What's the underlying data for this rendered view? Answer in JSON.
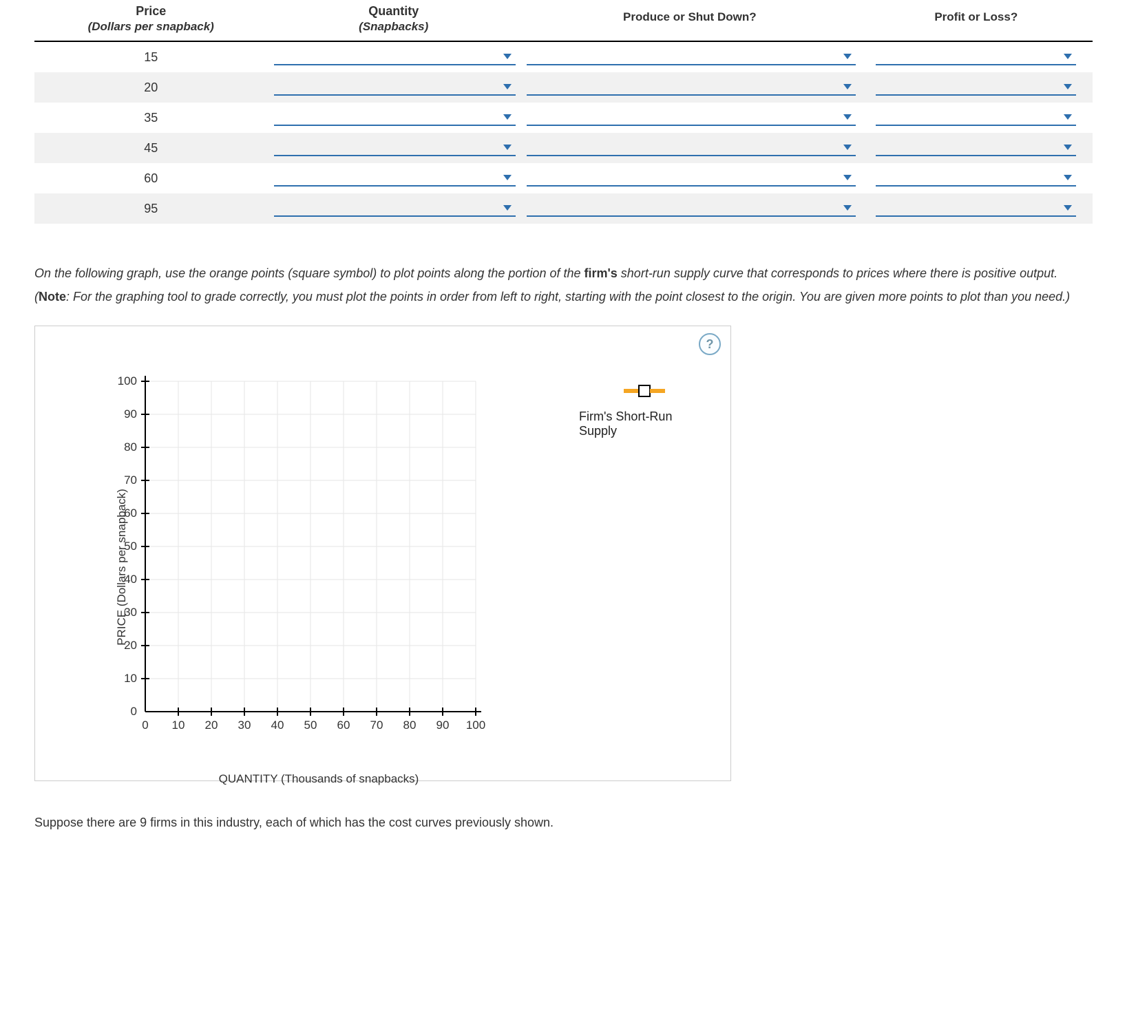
{
  "table": {
    "header": {
      "price": "Price",
      "price_sub": "(Dollars per snapback)",
      "quantity": "Quantity",
      "quantity_sub": "(Snapbacks)",
      "produce": "Produce or Shut Down?",
      "profit": "Profit or Loss?"
    },
    "prices": {
      "r0": "15",
      "r1": "20",
      "r2": "35",
      "r3": "45",
      "r4": "60",
      "r5": "95"
    }
  },
  "instructions": {
    "pre": "On the following graph, use the orange points (square symbol) to plot points along the portion of the ",
    "firm": "firm's",
    "mid": " short-run supply curve that corresponds to prices where there is positive output. (",
    "note": "Note",
    "post": ": For the graphing tool to grade correctly, you must plot the points in order from left to right, starting with the point closest to the origin. You are given more points to plot than you need.)"
  },
  "chart_data": {
    "type": "scatter",
    "title": "",
    "xlabel": "QUANTITY (Thousands of snapbacks)",
    "ylabel": "PRICE (Dollars per snapback)",
    "xlim": [
      0,
      100
    ],
    "ylim": [
      0,
      100
    ],
    "xticks": [
      "0",
      "10",
      "20",
      "30",
      "40",
      "50",
      "60",
      "70",
      "80",
      "90",
      "100"
    ],
    "yticks": [
      "0",
      "10",
      "20",
      "30",
      "40",
      "50",
      "60",
      "70",
      "80",
      "90",
      "100"
    ],
    "series": [
      {
        "name": "Firm's Short-Run Supply",
        "symbol": "square",
        "color": "#f5a623",
        "x": [],
        "y": []
      }
    ]
  },
  "legend_label": "Firm's Short-Run Supply",
  "help": "?",
  "trailer": "Suppose there are 9 firms in this industry, each of which has the cost curves previously shown."
}
